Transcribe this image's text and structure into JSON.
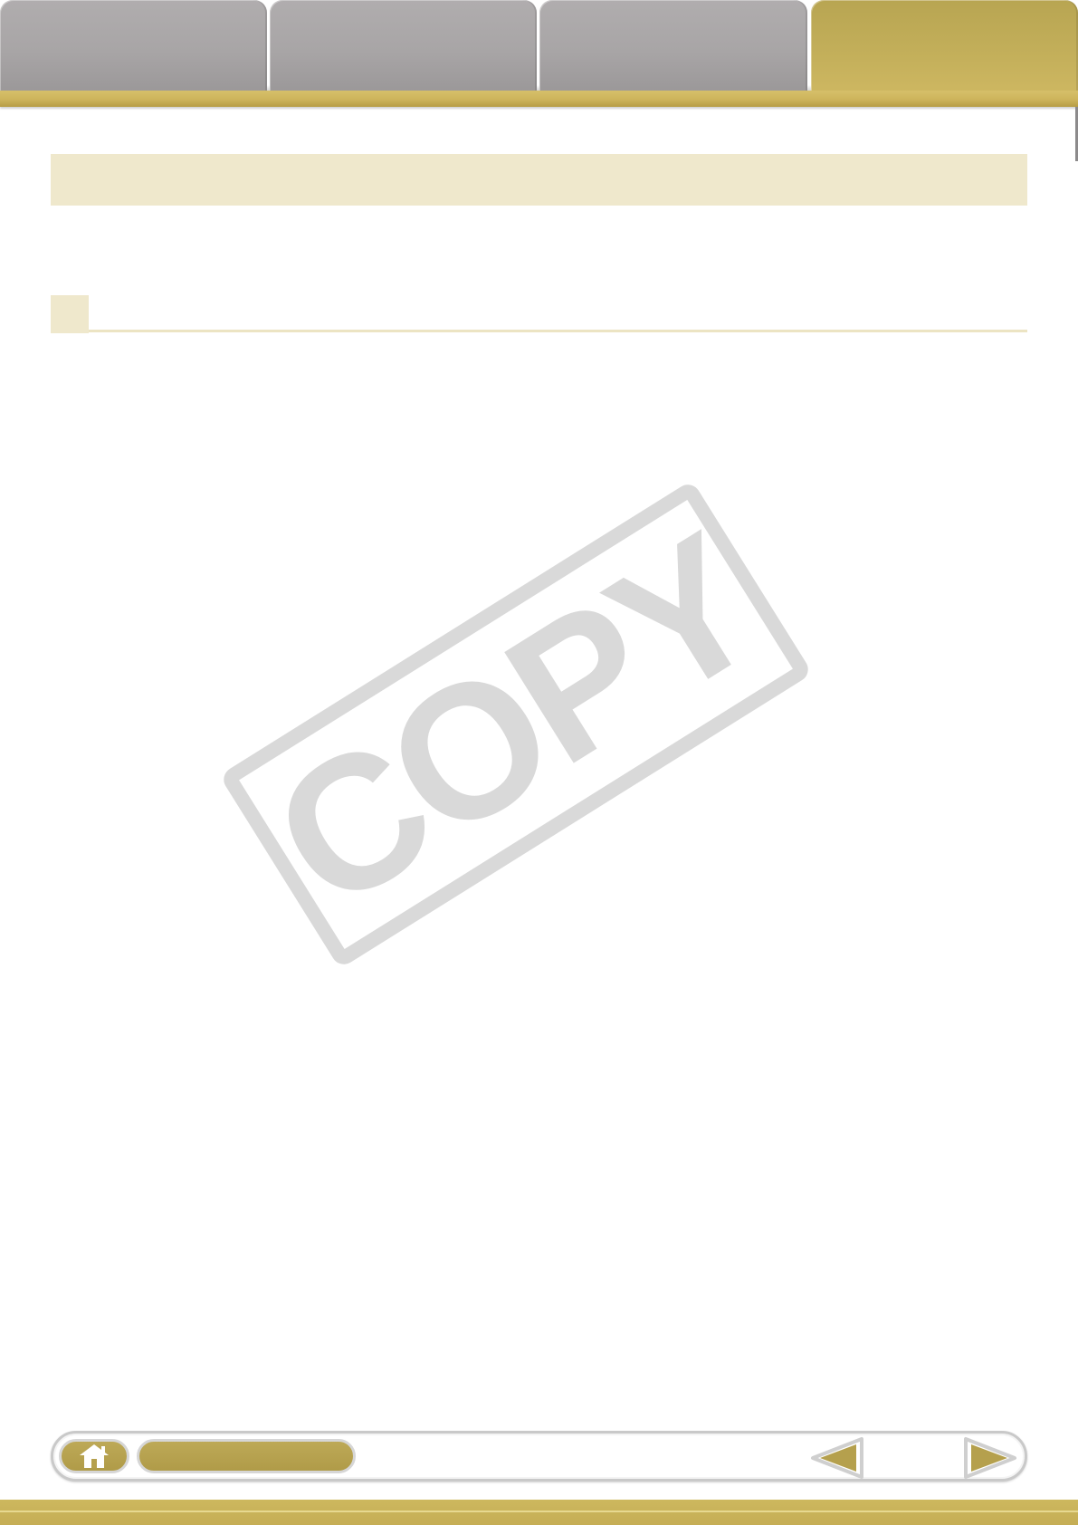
{
  "tabs": [
    {
      "label": ""
    },
    {
      "label": ""
    },
    {
      "label": ""
    },
    {
      "label": ""
    }
  ],
  "title": "",
  "section_heading": "",
  "watermark": {
    "text": "COPY",
    "color": "#d9d9d9"
  },
  "nav": {
    "chapter_label": "",
    "page_number": ""
  },
  "colors": {
    "accent_gold": "#c3ad57",
    "tab_gray": "#a8a5a6",
    "heading_band": "#efe8cc"
  }
}
